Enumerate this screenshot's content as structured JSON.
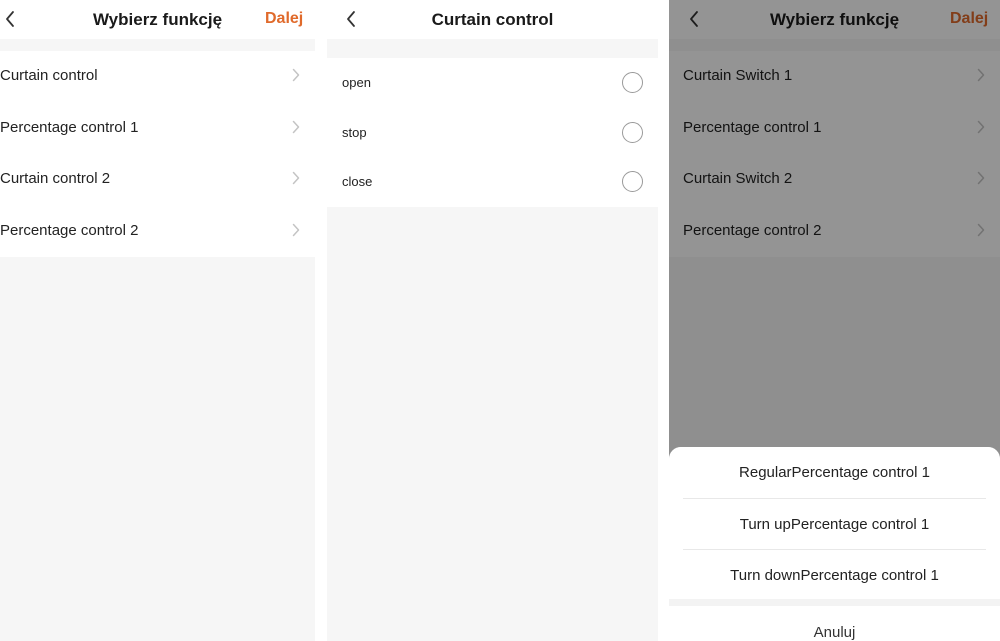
{
  "screens": {
    "functions": {
      "title": "Wybierz funkcję",
      "next_label": "Dalej",
      "items": [
        {
          "label": "Curtain control"
        },
        {
          "label": "Percentage control 1"
        },
        {
          "label": "Curtain control 2"
        },
        {
          "label": "Percentage control 2"
        }
      ]
    },
    "curtain_control": {
      "title": "Curtain control",
      "options": [
        {
          "label": "open",
          "selected": false
        },
        {
          "label": "stop",
          "selected": false
        },
        {
          "label": "close",
          "selected": false
        }
      ]
    },
    "functions_sheet": {
      "title": "Wybierz funkcję",
      "next_label": "Dalej",
      "items": [
        {
          "label": "Curtain Switch 1"
        },
        {
          "label": "Percentage control 1"
        },
        {
          "label": "Curtain Switch 2"
        },
        {
          "label": "Percentage control 2"
        }
      ],
      "sheet": {
        "options": [
          {
            "label": "RegularPercentage control 1"
          },
          {
            "label": "Turn upPercentage control 1"
          },
          {
            "label": "Turn downPercentage control 1"
          }
        ],
        "cancel_label": "Anuluj"
      }
    }
  },
  "colors": {
    "accent": "#e06a2b",
    "background": "#f6f6f6",
    "overlay": "rgba(0,0,0,0.42)"
  },
  "icons": {
    "back": "chevron-left-icon",
    "row": "chevron-right-icon",
    "radio": "radio-unchecked-icon"
  }
}
